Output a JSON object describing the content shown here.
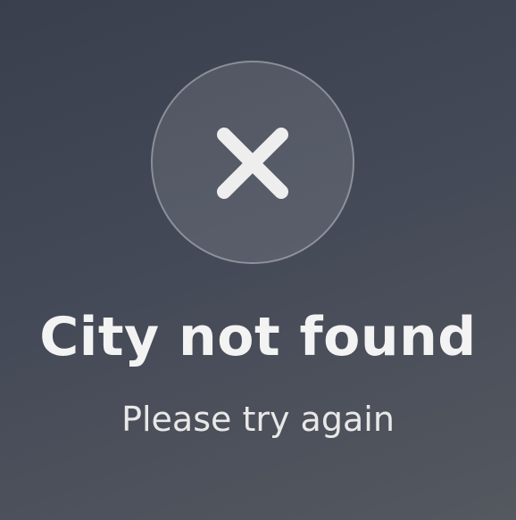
{
  "error": {
    "icon": "close-icon",
    "title": "City not found",
    "message": "Please try again"
  },
  "colors": {
    "background_top": "#3a3f4e",
    "background_bottom": "#54585f",
    "text": "#f3f3f3",
    "icon": "#eeeeee"
  }
}
